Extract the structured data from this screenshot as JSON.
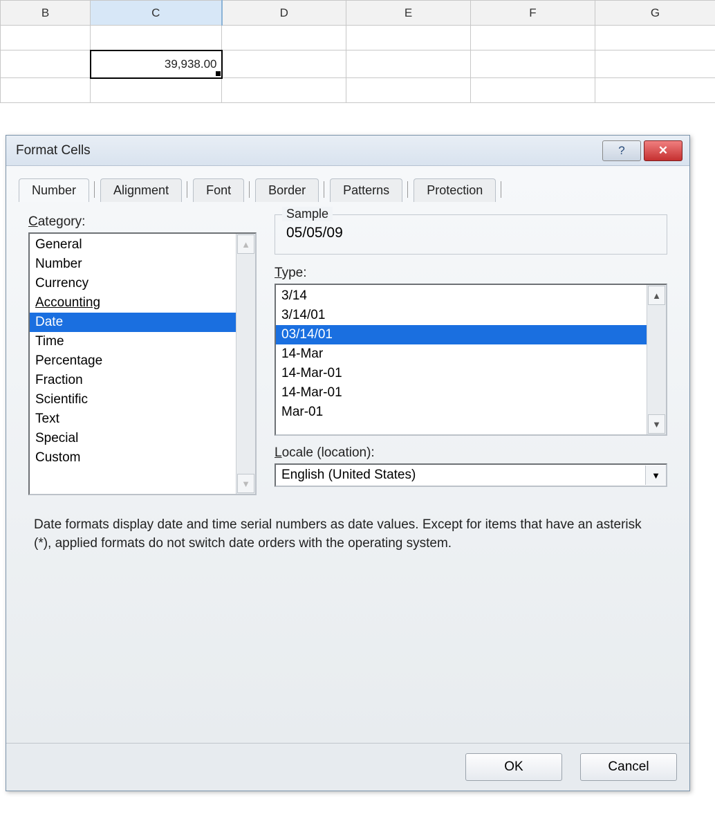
{
  "grid": {
    "columns": [
      "B",
      "C",
      "D",
      "E",
      "F",
      "G"
    ],
    "selected_col": "C",
    "selected_cell_value": "39,938.00"
  },
  "dialog": {
    "title": "Format Cells",
    "tabs": [
      "Number",
      "Alignment",
      "Font",
      "Border",
      "Patterns",
      "Protection"
    ],
    "active_tab": "Number",
    "category_label": "Category:",
    "categories": [
      "General",
      "Number",
      "Currency",
      "Accounting",
      "Date",
      "Time",
      "Percentage",
      "Fraction",
      "Scientific",
      "Text",
      "Special",
      "Custom"
    ],
    "underlined_category": "Accounting",
    "selected_category": "Date",
    "sample_label": "Sample",
    "sample_value": "05/05/09",
    "type_label": "Type:",
    "types": [
      "3/14",
      "3/14/01",
      "03/14/01",
      "14-Mar",
      "14-Mar-01",
      "14-Mar-01",
      "Mar-01"
    ],
    "selected_type": "03/14/01",
    "locale_label": "Locale (location):",
    "locale_value": "English (United States)",
    "description": "Date formats display date and time serial numbers as date values. Except for items that have an asterisk (*), applied formats do not switch date orders with the operating system.",
    "ok_label": "OK",
    "cancel_label": "Cancel"
  }
}
